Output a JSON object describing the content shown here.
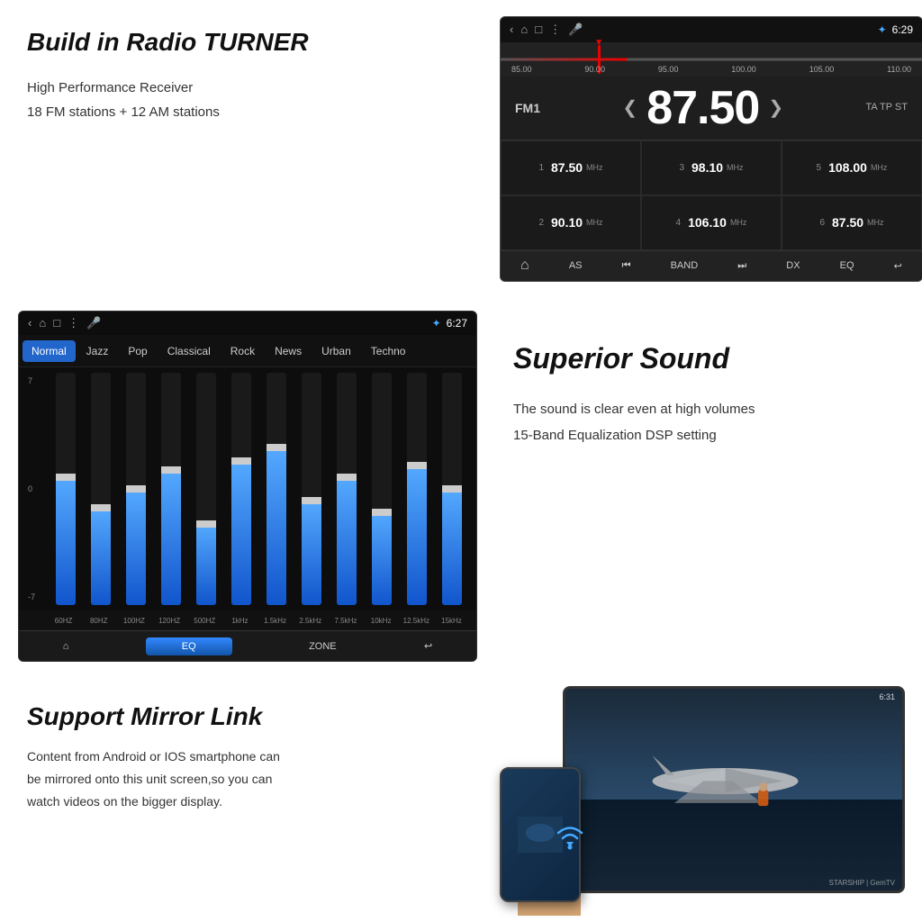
{
  "page": {
    "background": "#ffffff"
  },
  "section1": {
    "title": "Build in Radio TURNER",
    "feature1": "High Performance Receiver",
    "feature2": "18 FM stations + 12 AM stations",
    "radio_ui": {
      "statusbar": {
        "left_icons": [
          "‹",
          "⌂",
          "□",
          "⋮",
          "🎤"
        ],
        "bluetooth": "✦",
        "time": "6:29"
      },
      "tuner_labels": [
        "85.00",
        "90.00",
        "95.00",
        "100.00",
        "105.00",
        "110.00"
      ],
      "fm_label": "FM1",
      "frequency": "87.50",
      "ta_tp_st": "TA  TP  ST",
      "presets": [
        {
          "num": "1",
          "freq": "87.50",
          "unit": "MHz"
        },
        {
          "num": "3",
          "freq": "98.10",
          "unit": "MHz"
        },
        {
          "num": "5",
          "freq": "108.00",
          "unit": "MHz"
        },
        {
          "num": "2",
          "freq": "90.10",
          "unit": "MHz"
        },
        {
          "num": "4",
          "freq": "106.10",
          "unit": "MHz"
        },
        {
          "num": "6",
          "freq": "87.50",
          "unit": "MHz"
        }
      ],
      "toolbar_buttons": [
        "⌂",
        "AS",
        "⏮",
        "BAND",
        "⏭",
        "DX",
        "EQ",
        "↩"
      ]
    }
  },
  "section2": {
    "eq_ui": {
      "statusbar": {
        "left_icons": [
          "‹",
          "⌂",
          "□",
          "⋮",
          "🎤"
        ],
        "bluetooth": "✦",
        "time": "6:27"
      },
      "presets": [
        "Normal",
        "Jazz",
        "Pop",
        "Classical",
        "Rock",
        "News",
        "Urban",
        "Techno"
      ],
      "active_preset": "Normal",
      "db_labels": [
        "7",
        "0",
        "-7"
      ],
      "freq_labels": [
        "60HZ",
        "80HZ",
        "100HZ",
        "120HZ",
        "500HZ",
        "1kHz",
        "1.5kHz",
        "2.5kHz",
        "7.5kHz",
        "10kHz",
        "12.5kHz",
        "15kHz"
      ],
      "band_heights": [
        60,
        40,
        50,
        55,
        35,
        65,
        70,
        45,
        55,
        40,
        60,
        50
      ],
      "handle_positions": [
        40,
        60,
        50,
        45,
        65,
        35,
        30,
        55,
        45,
        60,
        40,
        50
      ],
      "toolbar_buttons": [
        "⌂",
        "EQ",
        "ZONE",
        "↩"
      ]
    },
    "title": "Superior Sound",
    "feature1": "The sound is clear even at high volumes",
    "feature2": "15-Band Equalization DSP setting"
  },
  "section3": {
    "title": "Support Mirror Link",
    "description_line1": "Content from Android or IOS smartphone can",
    "description_line2": "be mirrored onto this unit screen,so you can",
    "description_line3": "watch videos on the  bigger display.",
    "mirror_ui": {
      "statusbar_time": "6:31",
      "watermark": "STARSHIP | GemTV"
    }
  }
}
